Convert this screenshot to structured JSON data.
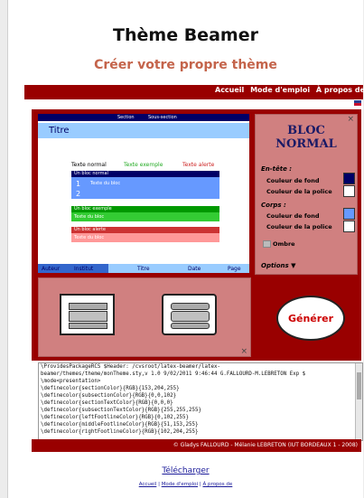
{
  "page": {
    "title": "Thème Beamer",
    "subtitle": "Créer votre propre thème"
  },
  "nav": {
    "items": [
      "Accueil",
      "Mode d'emploi",
      "À propos de"
    ]
  },
  "preview": {
    "section": "Section",
    "subsection": "Sous-section",
    "frame_title": "Titre",
    "text_normal": "Texte normal",
    "text_example": "Texte exemple",
    "text_alert": "Texte alerte",
    "block_normal_title": "Un bloc normal",
    "block_normal_item1_num": "1",
    "block_normal_item1": "Texte du bloc",
    "block_normal_item2_num": "2",
    "block_example_title": "Un bloc exemple",
    "block_example_body": "Texte du bloc",
    "block_alert_title": "Un bloc alerte",
    "block_alert_body": "Texte du bloc",
    "footer": [
      "Auteur",
      "Institut",
      "Titre",
      "Date",
      "Page"
    ]
  },
  "bloc_panel": {
    "title_line1": "BLOC",
    "title_line2": "NORMAL",
    "entete_label": "En-tête :",
    "corps_label": "Corps :",
    "bg_label": "Couleur de fond",
    "font_label": "Couleur de la police",
    "shadow_label": "Ombre",
    "options_label": "Options ▼",
    "close": "×",
    "colors": {
      "entete_bg": "#000066",
      "entete_font": "#ffffff",
      "corps_bg": "#6699ff",
      "corps_font": "#ffffff"
    }
  },
  "layout_panel": {
    "close": "×"
  },
  "generate": {
    "label": "Générer"
  },
  "code": {
    "lines": [
      "\\ProvidesPackageRCS $Header: /cvsroot/latex-beamer/latex-",
      "beamer/themes/theme/monTheme.sty,v 1.0 9/02/2011 9:46:44 G.FALLOURD-M.LEBRETON Exp $",
      "\\mode<presentation>",
      "\\definecolor{sectionColor}{RGB}{153,204,255}",
      "\\definecolor{subsectionColor}{RGB}{0,0,102}",
      "\\definecolor{sectionTextColor}{RGB}{0,0,0}",
      "\\definecolor{subsectionTextColor}{RGB}{255,255,255}",
      "\\definecolor{leftFootlineColor}{RGB}{0,102,255}",
      "\\definecolor{middleFootlineColor}{RGB}{51,153,255}",
      "\\definecolor{rightFootlineColor}{RGB}{102,204,255}"
    ]
  },
  "footer": {
    "credits": "© Gladys FALLOURD - Mélanie LEBRETON (IUT BORDEAUX 1 - 2008)",
    "download": "Télécharger",
    "links": [
      "Accueil",
      "Mode d'emploi",
      "À propos de"
    ]
  }
}
